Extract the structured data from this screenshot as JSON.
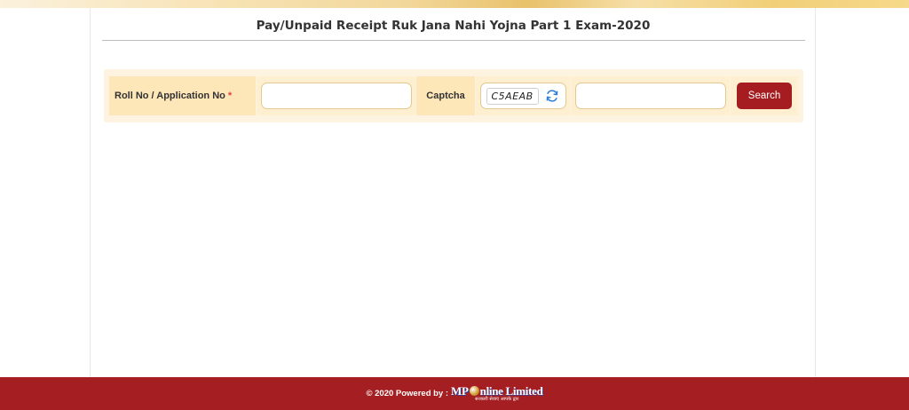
{
  "page": {
    "title": "Pay/Unpaid Receipt Ruk Jana Nahi Yojna Part 1 Exam-2020"
  },
  "form": {
    "roll_label": "Roll No / Application No",
    "required_mark": "*",
    "roll_value": "",
    "captcha_label": "Captcha",
    "captcha_code": "C5AEAB",
    "captcha_value": "",
    "search_label": "Search"
  },
  "footer": {
    "text": "© 2020 Powered by :",
    "logo_mp": "MP",
    "logo_rest": "nline Limited",
    "logo_tagline": "सरकारी सेवाएं आपके द्वार"
  },
  "colors": {
    "footer_bg": "#a51f22",
    "button_bg": "#a51c21",
    "label_bg": "#fde6b8",
    "panel_bg": "#fdf3e0",
    "required": "#e63c3c"
  },
  "icons": {
    "refresh": "refresh-icon",
    "globe": "globe-icon"
  }
}
